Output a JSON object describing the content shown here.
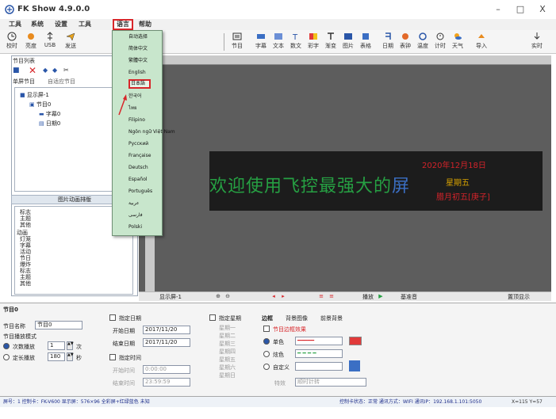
{
  "app": {
    "title": "FK Show 4.9.0.0",
    "minimize": "–",
    "maximize": "□",
    "close": "X"
  },
  "menu": {
    "items": [
      "工具",
      "系统",
      "设置",
      "工具",
      "语言",
      "帮助"
    ],
    "active_index": 4
  },
  "toolbar": {
    "left_buttons": [
      "校时",
      "亮度",
      "USB",
      "发送"
    ],
    "right_buttons": [
      "节目",
      "字幕",
      "文本",
      "数文",
      "彩字",
      "渐变",
      "图片",
      "表格",
      "日期",
      "表钟",
      "温度",
      "计时",
      "天气",
      "导入",
      "实时"
    ]
  },
  "left_panel": {
    "section_label": "节目列表",
    "tabs": [
      "单屏节目",
      "自适应节目"
    ],
    "tree": [
      "显示屏-1",
      "节目0",
      "字幕0",
      "日期0"
    ],
    "mid_header": "图片动画排版",
    "list": [
      "标志",
      "主题",
      "其他",
      "动画",
      "灯笼",
      "字幕",
      "活动",
      "节日",
      "爆炸",
      "标志",
      "主题",
      "其他"
    ]
  },
  "language_menu": {
    "items": [
      "自动选择",
      "简体中文",
      "繁體中文",
      "English",
      "日本語",
      "한국어",
      "ไทย",
      "Filipino",
      "Ngôn ngữ Việt Nam",
      "Русский",
      "Française",
      "Deutsch",
      "Español",
      "Português",
      "عربية",
      "فارسی",
      "Polski"
    ],
    "selected_index": 4
  },
  "led_display": {
    "scroll_text": "欢迎使用飞控最强大的",
    "scroll_tail": "屏",
    "date": "2020年12月18日",
    "weekday": "星期五",
    "lunar": "腊月初五[庚子]"
  },
  "play_bar": {
    "screen_label": "显示屏-1",
    "keep_label": "置顶显示",
    "play_label": "播放",
    "count_label": "基准音"
  },
  "props": {
    "title": "节目0",
    "name_label": "节目名称",
    "name_value": "节目0",
    "mode_label": "节目播放模式",
    "count_play_label": "次数播放",
    "count_value": "1",
    "count_unit": "次",
    "fixed_play_label": "定长播放",
    "fixed_value": "180",
    "fixed_unit": "秒",
    "specify_date_label": "指定日期",
    "start_date_label": "开始日期",
    "start_date": "2017/11/20",
    "end_date_label": "结束日期",
    "end_date": "2017/11/20",
    "specify_time_label": "指定时间",
    "start_time_label": "开始时间",
    "start_time": "0:00:00",
    "end_time_label": "结束时间",
    "end_time": "23:59:59",
    "week_label": "指定星期",
    "weekdays": [
      "星期一",
      "星期二",
      "星期三",
      "星期四",
      "星期五",
      "星期六",
      "星期日"
    ],
    "tabs": [
      "边框",
      "背景图像",
      "前景背景"
    ],
    "border_check": "节目边框效果",
    "border_opt1": "单色",
    "border_opt2": "炫色",
    "border_opt3": "自定义",
    "speed_label": "特效",
    "speed_value": "顺时针转"
  },
  "status": {
    "left": "屏号：1 控制卡：FK-V600 显示屏：576×96 全彩屏+红绿蓝色 未知",
    "right": "控制卡状态：正常  通讯方式：WIFI 通讯IP：192.168.1.101:5050",
    "coords": "X=115 Y=57"
  },
  "colors": {
    "accent_red": "#d8262a",
    "dropdown_bg": "#c8e6cc",
    "canvas_bg": "#5d5d5d"
  }
}
